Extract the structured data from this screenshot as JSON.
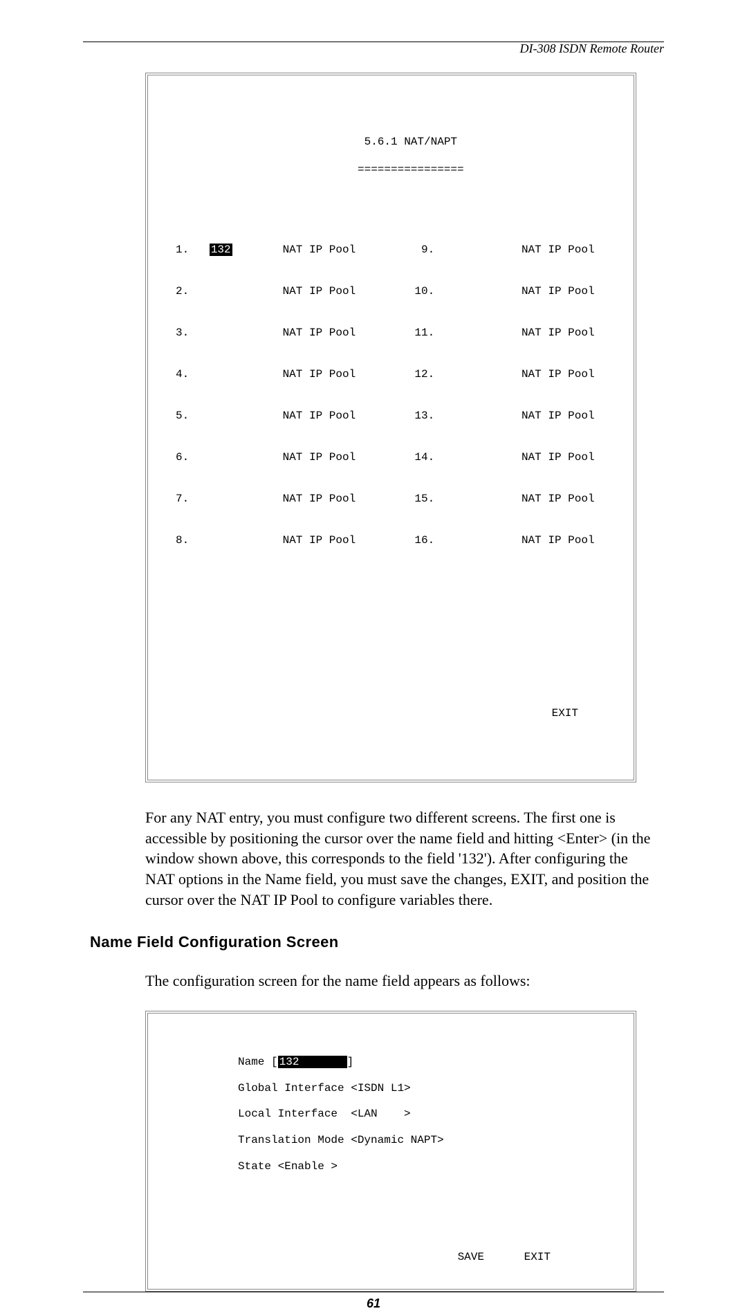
{
  "header": {
    "product": "DI-308 ISDN Remote Router"
  },
  "terminal1": {
    "title": "5.6.1 NAT/NAPT",
    "underline": "================",
    "rows": [
      {
        "ln": "1.",
        "name": "132",
        "link": "NAT IP Pool",
        "rn": "9.",
        "rlink": "NAT IP Pool"
      },
      {
        "ln": "2.",
        "name": "",
        "link": "NAT IP Pool",
        "rn": "10.",
        "rlink": "NAT IP Pool"
      },
      {
        "ln": "3.",
        "name": "",
        "link": "NAT IP Pool",
        "rn": "11.",
        "rlink": "NAT IP Pool"
      },
      {
        "ln": "4.",
        "name": "",
        "link": "NAT IP Pool",
        "rn": "12.",
        "rlink": "NAT IP Pool"
      },
      {
        "ln": "5.",
        "name": "",
        "link": "NAT IP Pool",
        "rn": "13.",
        "rlink": "NAT IP Pool"
      },
      {
        "ln": "6.",
        "name": "",
        "link": "NAT IP Pool",
        "rn": "14.",
        "rlink": "NAT IP Pool"
      },
      {
        "ln": "7.",
        "name": "",
        "link": "NAT IP Pool",
        "rn": "15.",
        "rlink": "NAT IP Pool"
      },
      {
        "ln": "8.",
        "name": "",
        "link": "NAT IP Pool",
        "rn": "16.",
        "rlink": "NAT IP Pool"
      }
    ],
    "exit": "EXIT"
  },
  "para1": "For any NAT entry, you must configure two different screens. The first one is accessible by positioning the cursor over the name field and hitting <Enter> (in the window shown above, this corresponds to the field '132'). After configuring the NAT options in the Name field, you must save the changes, EXIT, and position the cursor over the NAT IP Pool to configure variables there.",
  "section_heading": "Name Field Configuration Screen",
  "para2": "The configuration screen for the name field appears as follows:",
  "terminal2": {
    "name_label": "Name [",
    "name_value": "132       ",
    "name_close": "]",
    "global_if": "Global Interface <ISDN L1>",
    "local_if": "Local Interface  <LAN    >",
    "trans_mode": "Translation Mode <Dynamic NAPT>",
    "state": "State <Enable >",
    "save": "SAVE",
    "exit": "EXIT"
  },
  "footer": {
    "page": "61"
  }
}
